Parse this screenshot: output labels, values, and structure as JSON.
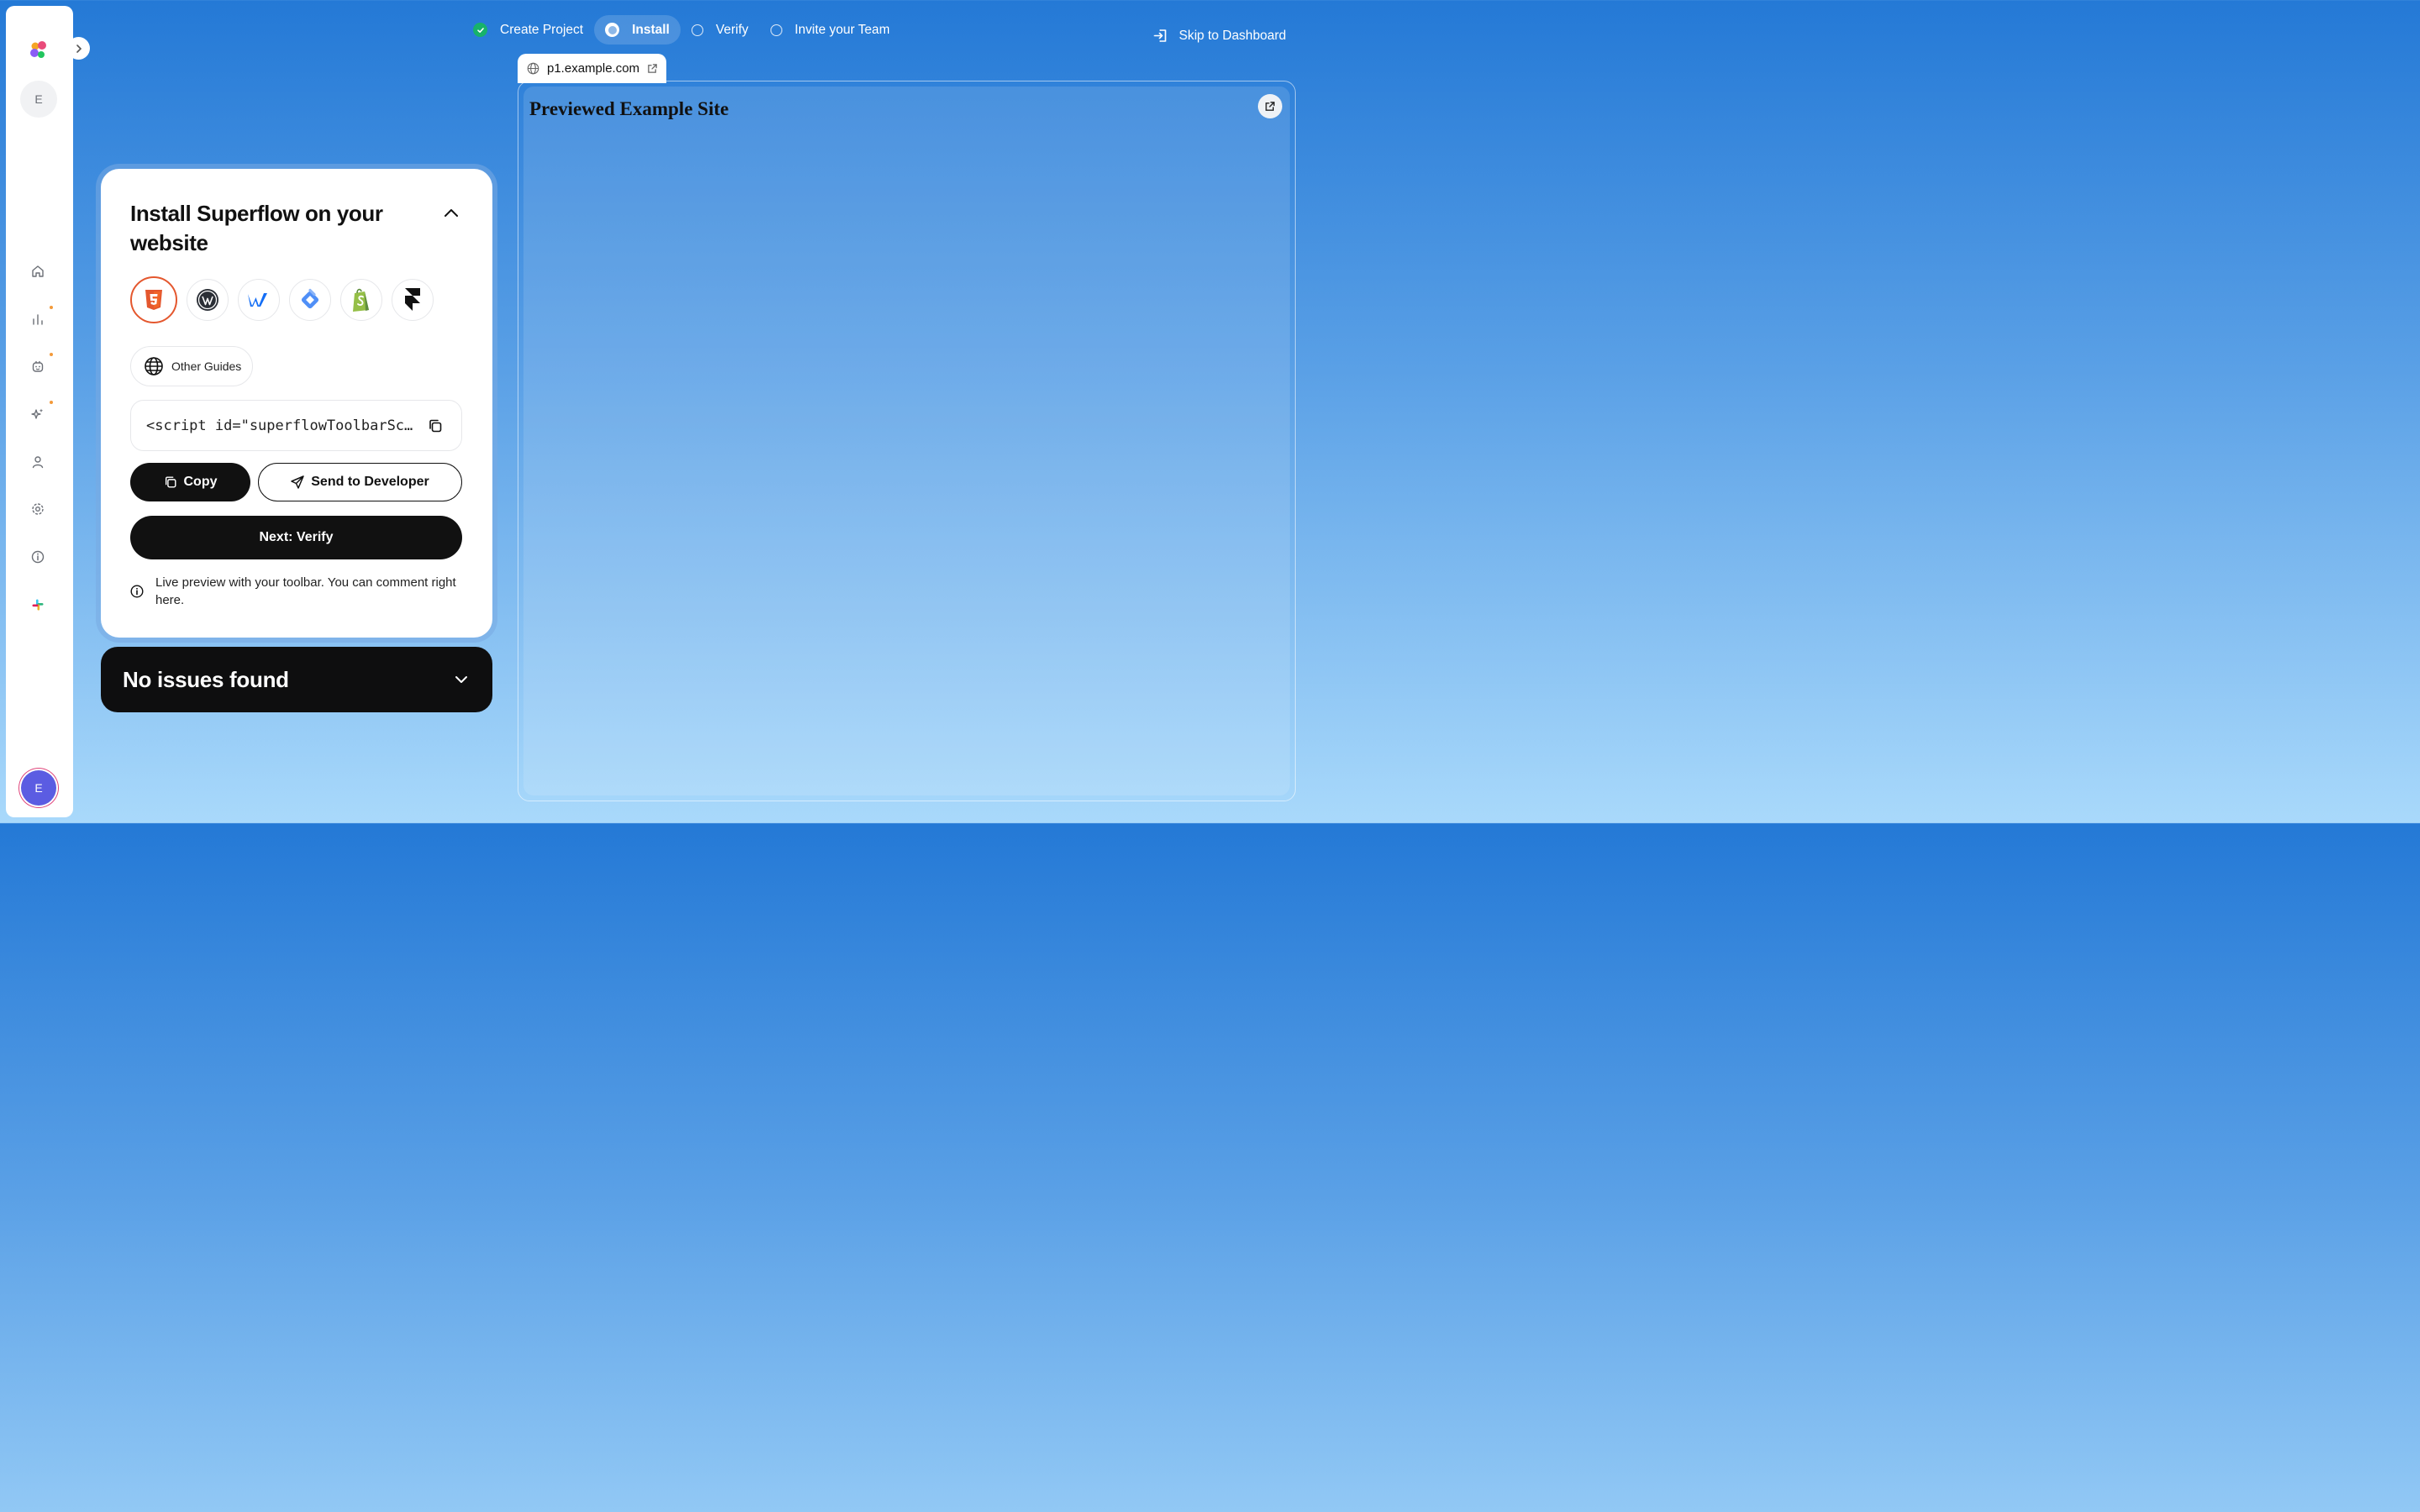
{
  "sidebar": {
    "workspace_initial": "E",
    "user_initial": "E",
    "nav_items": [
      {
        "name": "home-icon"
      },
      {
        "name": "analytics-icon",
        "badge": true
      },
      {
        "name": "bot-icon",
        "badge": true
      },
      {
        "name": "sparkles-icon",
        "badge": true
      },
      {
        "name": "user-icon"
      },
      {
        "name": "settings-icon"
      },
      {
        "name": "info-icon"
      },
      {
        "name": "slack-icon"
      }
    ]
  },
  "stepper": {
    "steps": [
      {
        "label": "Create Project",
        "state": "done"
      },
      {
        "label": "Install",
        "state": "active"
      },
      {
        "label": "Verify",
        "state": "pending"
      },
      {
        "label": "Invite your Team",
        "state": "pending"
      }
    ]
  },
  "skip_label": "Skip to Dashboard",
  "install_card": {
    "title": "Install Superflow on your website",
    "platforms": [
      "html5",
      "wordpress",
      "webflow",
      "google-tag-manager",
      "shopify",
      "framer"
    ],
    "selected_platform": "html5",
    "other_guides_label": "Other Guides",
    "code_snippet": "<script id=\"superflowToolbarScript\"",
    "copy_label": "Copy",
    "send_label": "Send to Developer",
    "next_label": "Next: Verify",
    "info_text": "Live preview with your toolbar. You can comment right here."
  },
  "issues": {
    "title": "No issues found"
  },
  "preview": {
    "url": "p1.example.com",
    "site_title": "Previewed Example Site"
  },
  "colors": {
    "accent_orange": "#e4572e",
    "success_green": "#17b26a",
    "background_top": "#2479d6",
    "background_bottom": "#a9d9fb"
  }
}
